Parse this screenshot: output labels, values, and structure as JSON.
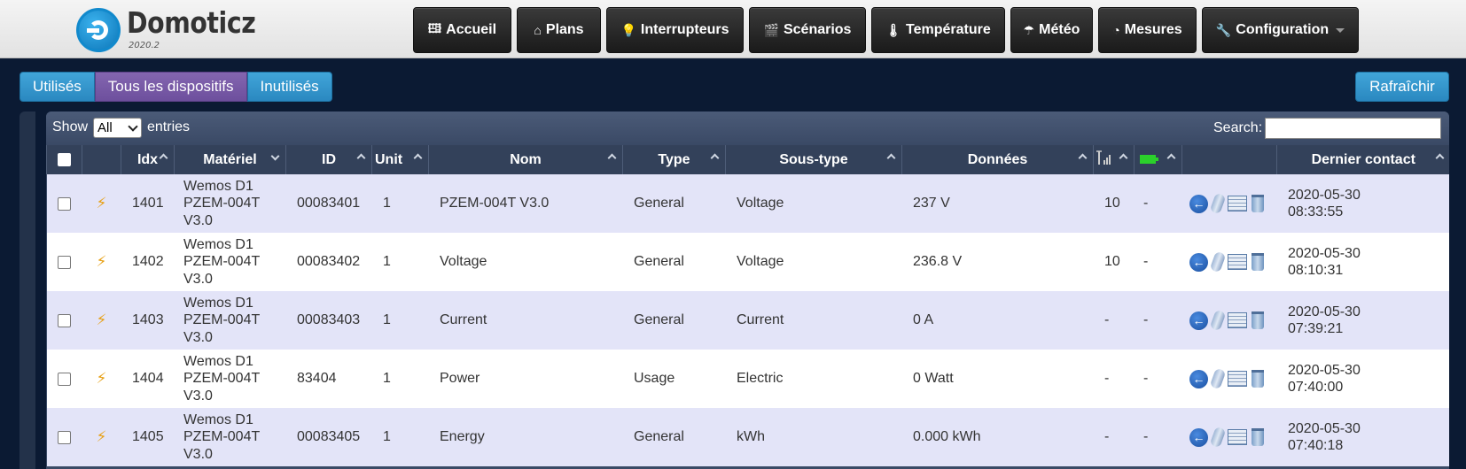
{
  "app": {
    "brand": "Domoticz",
    "version": "2020.2"
  },
  "nav": [
    {
      "label": "Accueil",
      "icon": "🖽"
    },
    {
      "label": "Plans",
      "icon": "⌂"
    },
    {
      "label": "Interrupteurs",
      "icon": "💡"
    },
    {
      "label": "Scénarios",
      "icon": "🎬"
    },
    {
      "label": "Température",
      "icon": "🌡"
    },
    {
      "label": "Météo",
      "icon": "☂"
    },
    {
      "label": "Mesures",
      "icon": "◔"
    },
    {
      "label": "Configuration",
      "icon": "🔧"
    }
  ],
  "filter": {
    "used": "Utilisés",
    "all": "Tous les dispositifs",
    "unused": "Inutilisés",
    "active": "all"
  },
  "refresh_label": "Rafraîchir",
  "toolbar": {
    "show_label": "Show",
    "show_value": "All",
    "entries_label": "entries",
    "search_label": "Search:"
  },
  "columns": {
    "idx": "Idx",
    "hardware": "Matériel",
    "id": "ID",
    "unit": "Unit",
    "name": "Nom",
    "type": "Type",
    "subtype": "Sous-type",
    "data": "Données",
    "signal_icon": "signal-icon",
    "battery_icon": "battery-icon",
    "last_seen": "Dernier contact"
  },
  "rows": [
    {
      "idx": "1401",
      "hardware": [
        "Wemos D1",
        "PZEM-004T",
        "V3.0"
      ],
      "id": "00083401",
      "unit": "1",
      "name": "PZEM-004T V3.0",
      "type": "General",
      "subtype": "Voltage",
      "data": "237 V",
      "signal": "10",
      "battery": "-",
      "last_date": "2020-05-30",
      "last_time": "08:33:55"
    },
    {
      "idx": "1402",
      "hardware": [
        "Wemos D1",
        "PZEM-004T",
        "V3.0"
      ],
      "id": "00083402",
      "unit": "1",
      "name": "Voltage",
      "type": "General",
      "subtype": "Voltage",
      "data": "236.8 V",
      "signal": "10",
      "battery": "-",
      "last_date": "2020-05-30",
      "last_time": "08:10:31"
    },
    {
      "idx": "1403",
      "hardware": [
        "Wemos D1",
        "PZEM-004T",
        "V3.0"
      ],
      "id": "00083403",
      "unit": "1",
      "name": "Current",
      "type": "General",
      "subtype": "Current",
      "data": "0 A",
      "signal": "-",
      "battery": "-",
      "last_date": "2020-05-30",
      "last_time": "07:39:21"
    },
    {
      "idx": "1404",
      "hardware": [
        "Wemos D1",
        "PZEM-004T",
        "V3.0"
      ],
      "id": "83404",
      "unit": "1",
      "name": "Power",
      "type": "Usage",
      "subtype": "Electric",
      "data": "0 Watt",
      "signal": "-",
      "battery": "-",
      "last_date": "2020-05-30",
      "last_time": "07:40:00"
    },
    {
      "idx": "1405",
      "hardware": [
        "Wemos D1",
        "PZEM-004T",
        "V3.0"
      ],
      "id": "00083405",
      "unit": "1",
      "name": "Energy",
      "type": "General",
      "subtype": "kWh",
      "data": "0.000 kWh",
      "signal": "-",
      "battery": "-",
      "last_date": "2020-05-30",
      "last_time": "07:40:18"
    }
  ]
}
